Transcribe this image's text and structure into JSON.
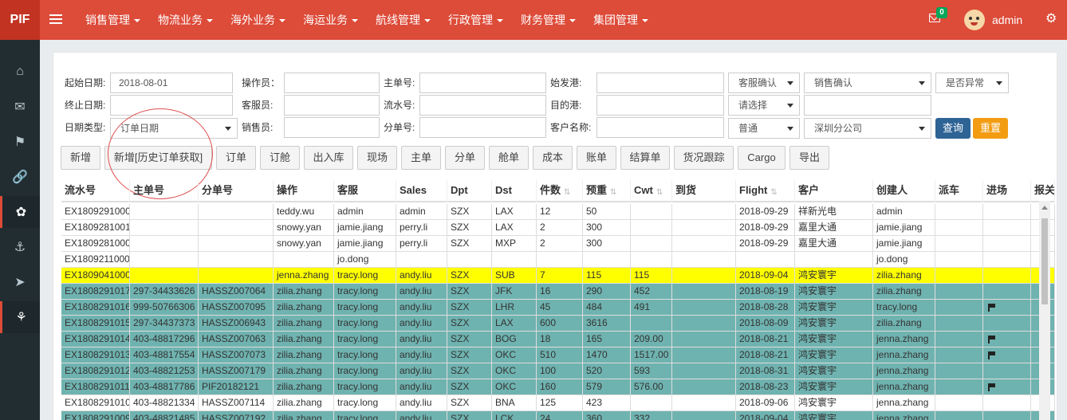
{
  "app": {
    "brand": "PIF",
    "username": "admin",
    "mail_count": "0"
  },
  "top_menu": [
    "销售管理",
    "物流业务",
    "海外业务",
    "海运业务",
    "航线管理",
    "行政管理",
    "财务管理",
    "集团管理"
  ],
  "sidebar_icons": [
    "home-icon",
    "envelope-icon",
    "flag-icon",
    "link-icon",
    "leaf-icon",
    "ship-icon",
    "rocket-icon",
    "anchor-icon"
  ],
  "form": {
    "start_date_label": "起始日期:",
    "start_date": "2018-08-01",
    "end_date_label": "终止日期:",
    "end_date": "",
    "date_type_label": "日期类型:",
    "date_type": "订单日期",
    "operator_label": "操作员：",
    "operator": "",
    "cs_label": "客服员:",
    "cs": "",
    "sales_label": "销售员:",
    "sales": "",
    "mawb_label": "主单号:",
    "mawb": "",
    "serial_label": "流水号:",
    "serial": "",
    "hawb_label": "分单号:",
    "hawb": "",
    "origin_label": "始发港:",
    "origin": "",
    "dest_label": "目的港:",
    "dest": "",
    "customer_label": "客户名称:",
    "customer": "",
    "cs_confirm": "客服确认",
    "please_select": "请选择",
    "normal": "普通",
    "sales_confirm": "销售确认",
    "extra": "",
    "branch": "深圳分公司",
    "abnormal": "是否异常",
    "query": "查询",
    "reset": "重置"
  },
  "actions": [
    "新增",
    "新增[历史订单获取]",
    "订单",
    "订舱",
    "出入库",
    "现场",
    "主单",
    "分单",
    "舱单",
    "成本",
    "账单",
    "结算单",
    "货况跟踪",
    "Cargo",
    "导出"
  ],
  "columns": [
    "流水号",
    "主单号",
    "分单号",
    "操作",
    "客服",
    "Sales",
    "Dpt",
    "Dst",
    "件数",
    "预重",
    "Cwt",
    "到货",
    "Flight",
    "客户",
    "创建人",
    "派车",
    "进场",
    "报关"
  ],
  "sortable": [
    false,
    false,
    false,
    false,
    false,
    false,
    false,
    false,
    true,
    true,
    true,
    false,
    true,
    false,
    false,
    false,
    false,
    false
  ],
  "colors": {
    "yellow": "#ffff00",
    "teal": "#6fb3b0",
    "header_red": "#dd4b39",
    "sidebar": "#222d32",
    "query_blue": "#2e6395",
    "reset_orange": "#f39c12"
  },
  "rows": [
    {
      "style": "white",
      "flag": false,
      "cells": [
        "EX1809291000",
        "",
        "",
        "teddy.wu",
        "admin",
        "admin",
        "SZX",
        "LAX",
        "12",
        "50",
        "",
        "",
        "2018-09-29",
        "祥新光电",
        "admin",
        "",
        "",
        ""
      ]
    },
    {
      "style": "white",
      "flag": false,
      "cells": [
        "EX1809281001",
        "",
        "",
        "snowy.yan",
        "jamie.jiang",
        "perry.li",
        "SZX",
        "LAX",
        "2",
        "300",
        "",
        "",
        "2018-09-29",
        "嘉里大通",
        "jamie.jiang",
        "",
        "",
        ""
      ]
    },
    {
      "style": "white",
      "flag": false,
      "cells": [
        "EX1809281000",
        "",
        "",
        "snowy.yan",
        "jamie.jiang",
        "perry.li",
        "SZX",
        "MXP",
        "2",
        "300",
        "",
        "",
        "2018-09-29",
        "嘉里大通",
        "jamie.jiang",
        "",
        "",
        ""
      ]
    },
    {
      "style": "white",
      "flag": false,
      "cells": [
        "EX1809211000",
        "",
        "",
        "",
        "jo.dong",
        "",
        "",
        "",
        "",
        "",
        "",
        "",
        "",
        "",
        "jo.dong",
        "",
        "",
        ""
      ]
    },
    {
      "style": "yellow",
      "flag": false,
      "cells": [
        "EX1809041000",
        "",
        "",
        "jenna.zhang",
        "tracy.long",
        "andy.liu",
        "SZX",
        "SUB",
        "7",
        "115",
        "115",
        "",
        "2018-09-04",
        "鸿安寰宇",
        "zilia.zhang",
        "",
        "",
        ""
      ]
    },
    {
      "style": "teal",
      "flag": false,
      "cells": [
        "EX1808291017",
        "297-34433626",
        "HASSZ007064",
        "zilia.zhang",
        "tracy.long",
        "andy.liu",
        "SZX",
        "JFK",
        "16",
        "290",
        "452",
        "",
        "2018-08-19",
        "鸿安寰宇",
        "zilia.zhang",
        "",
        "",
        ""
      ]
    },
    {
      "style": "teal",
      "flag": true,
      "cells": [
        "EX1808291016",
        "999-50766306",
        "HASSZ007095",
        "zilia.zhang",
        "tracy.long",
        "andy.liu",
        "SZX",
        "LHR",
        "45",
        "484",
        "491",
        "",
        "2018-08-28",
        "鸿安寰宇",
        "tracy.long",
        "",
        "",
        ""
      ]
    },
    {
      "style": "teal",
      "flag": false,
      "cells": [
        "EX1808291015",
        "297-34437373",
        "HASSZ006943",
        "zilia.zhang",
        "tracy.long",
        "andy.liu",
        "SZX",
        "LAX",
        "600",
        "3616",
        "",
        "",
        "2018-08-09",
        "鸿安寰宇",
        "zilia.zhang",
        "",
        "",
        ""
      ]
    },
    {
      "style": "teal",
      "flag": true,
      "cells": [
        "EX1808291014",
        "403-48817296",
        "HASSZ007063",
        "zilia.zhang",
        "tracy.long",
        "andy.liu",
        "SZX",
        "BOG",
        "18",
        "165",
        "209.00",
        "",
        "2018-08-21",
        "鸿安寰宇",
        "jenna.zhang",
        "",
        "",
        ""
      ]
    },
    {
      "style": "teal",
      "flag": true,
      "cells": [
        "EX1808291013",
        "403-48817554",
        "HASSZ007073",
        "zilia.zhang",
        "tracy.long",
        "andy.liu",
        "SZX",
        "OKC",
        "510",
        "1470",
        "1517.00",
        "",
        "2018-08-21",
        "鸿安寰宇",
        "jenna.zhang",
        "",
        "",
        ""
      ]
    },
    {
      "style": "teal",
      "flag": false,
      "cells": [
        "EX1808291012",
        "403-48821253",
        "HASSZ007179",
        "zilia.zhang",
        "tracy.long",
        "andy.liu",
        "SZX",
        "OKC",
        "100",
        "520",
        "593",
        "",
        "2018-08-31",
        "鸿安寰宇",
        "jenna.zhang",
        "",
        "",
        ""
      ]
    },
    {
      "style": "teal",
      "flag": true,
      "cells": [
        "EX1808291011",
        "403-48817786",
        "PIF20182121",
        "zilia.zhang",
        "tracy.long",
        "andy.liu",
        "SZX",
        "OKC",
        "160",
        "579",
        "576.00",
        "",
        "2018-08-23",
        "鸿安寰宇",
        "jenna.zhang",
        "",
        "",
        ""
      ]
    },
    {
      "style": "white",
      "flag": false,
      "cells": [
        "EX1808291010",
        "403-48821334",
        "HASSZ007114",
        "zilia.zhang",
        "tracy.long",
        "andy.liu",
        "SZX",
        "BNA",
        "125",
        "423",
        "",
        "",
        "2018-09-06",
        "鸿安寰宇",
        "jenna.zhang",
        "",
        "",
        ""
      ]
    },
    {
      "style": "teal",
      "flag": false,
      "cells": [
        "EX1808291009",
        "403-48821485",
        "HASSZ007192",
        "zilia.zhang",
        "tracy.long",
        "andy.liu",
        "SZX",
        "LCK",
        "24",
        "360",
        "332",
        "",
        "2018-09-04",
        "鸿安寰宇",
        "jenna.zhang",
        "",
        "",
        ""
      ]
    }
  ]
}
